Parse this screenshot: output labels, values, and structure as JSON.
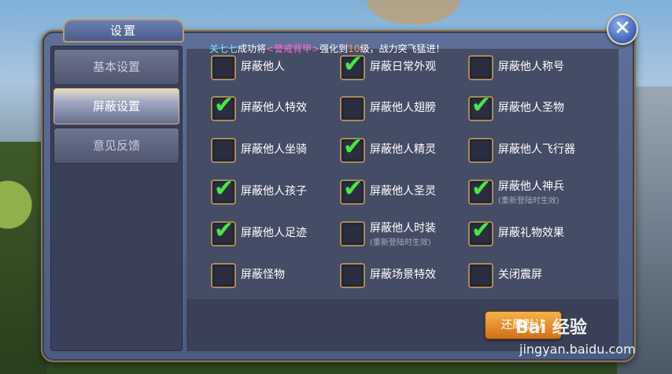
{
  "window": {
    "title": "设置",
    "close_symbol": "✕"
  },
  "notice": {
    "player": "关七七",
    "text1": "成功将",
    "item": "<警戒背甲>",
    "text2": "强化到",
    "level": "10",
    "text3": "级，战力突飞猛进！"
  },
  "sidebar": {
    "items": [
      {
        "label": "基本设置",
        "active": false
      },
      {
        "label": "屏蔽设置",
        "active": true
      },
      {
        "label": "意见反馈",
        "active": false
      }
    ]
  },
  "options": [
    {
      "label": "屏蔽他人",
      "checked": false
    },
    {
      "label": "屏蔽日常外观",
      "checked": true
    },
    {
      "label": "屏蔽他人称号",
      "checked": false
    },
    {
      "label": "屏蔽他人特效",
      "checked": true
    },
    {
      "label": "屏蔽他人翅膀",
      "checked": false
    },
    {
      "label": "屏蔽他人圣物",
      "checked": true
    },
    {
      "label": "屏蔽他人坐骑",
      "checked": false
    },
    {
      "label": "屏蔽他人精灵",
      "checked": true
    },
    {
      "label": "屏蔽他人飞行器",
      "checked": false
    },
    {
      "label": "屏蔽他人孩子",
      "checked": true
    },
    {
      "label": "屏蔽他人圣灵",
      "checked": true
    },
    {
      "label": "屏蔽他人神兵",
      "sub": "(重新登陆时生效)",
      "checked": true
    },
    {
      "label": "屏蔽他人足迹",
      "checked": true
    },
    {
      "label": "屏蔽他人时装",
      "sub": "(重新登陆时生效)",
      "checked": false
    },
    {
      "label": "屏蔽礼物效果",
      "checked": true
    },
    {
      "label": "屏蔽怪物",
      "checked": false
    },
    {
      "label": "屏蔽场景特效",
      "checked": false
    },
    {
      "label": "关闭震屏",
      "checked": false
    }
  ],
  "check_symbol": "✔",
  "footer": {
    "restore_label": "还原默认"
  },
  "watermark": {
    "brand": "Bai 经验",
    "url": "jingyan.baidu.com"
  },
  "colors": {
    "check": "#4fe34a",
    "notice_player": "#7fe0ff",
    "notice_item": "#ff6ec8",
    "notice_level": "#ff9b3d"
  }
}
